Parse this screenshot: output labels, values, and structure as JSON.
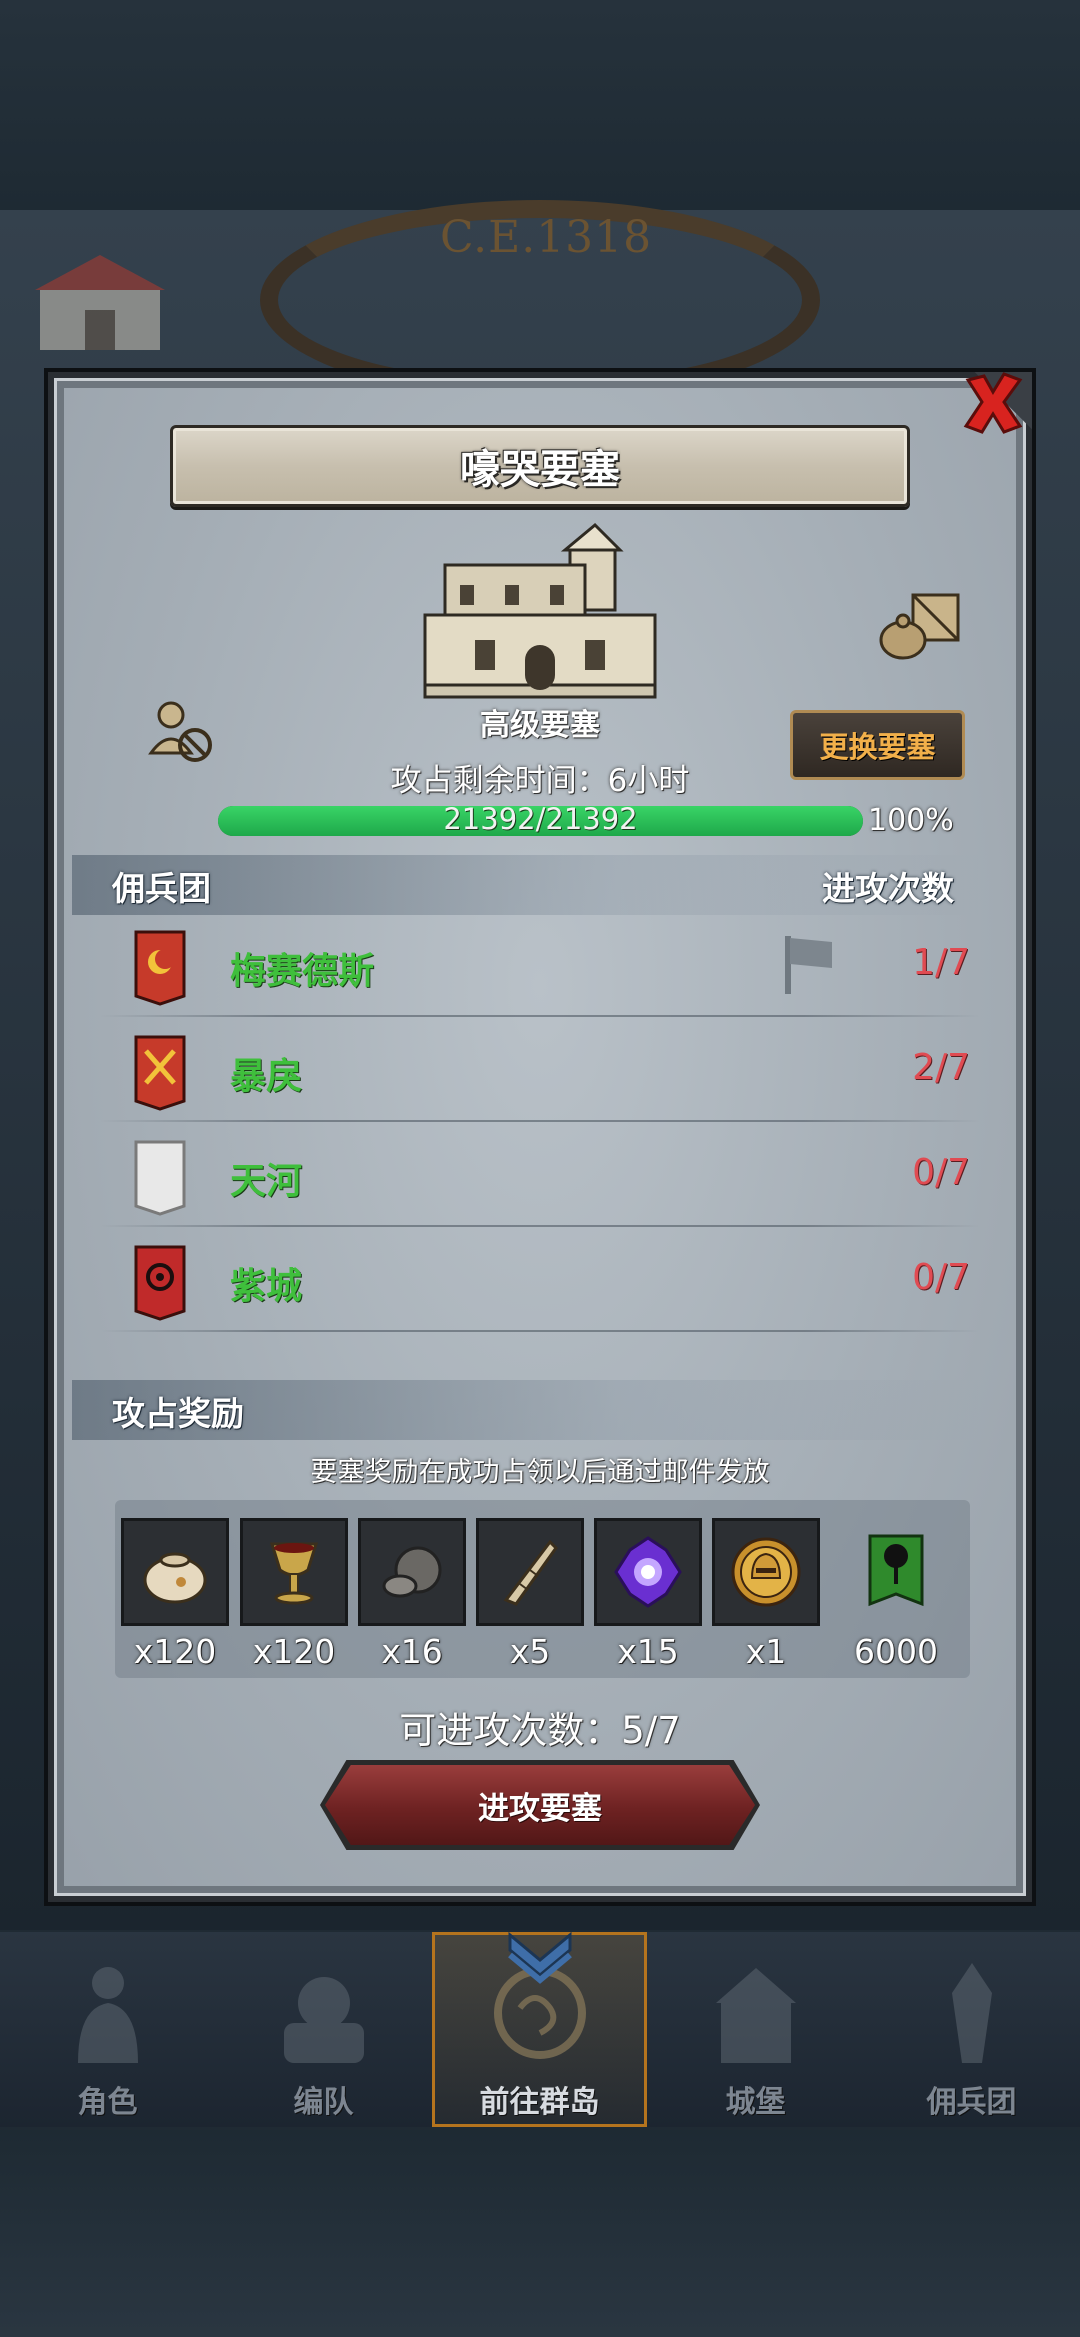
{
  "top": {
    "era": "C.E.1318"
  },
  "modal": {
    "title": "嚎哭要塞",
    "fortress_type": "高级要塞",
    "change_button": "更换要塞",
    "timer_label": "攻占剩余时间：6小时",
    "hp": {
      "current": 21392,
      "max": 21392,
      "text": "21392/21392",
      "percent_text": "100%",
      "fill_fraction": 1.0
    }
  },
  "mercenaries": {
    "header_left": "佣兵团",
    "header_right": "进攻次数",
    "rows": [
      {
        "name": "梅赛德斯",
        "count": "1/7",
        "banner_color": "#c63a2a",
        "emblem": "crescent-moon",
        "flag": true
      },
      {
        "name": "暴戾",
        "count": "2/7",
        "banner_color": "#c63a2a",
        "emblem": "crossed-swords",
        "flag": false
      },
      {
        "name": "天河",
        "count": "0/7",
        "banner_color": "#e8e8e8",
        "emblem": "blank",
        "flag": false
      },
      {
        "name": "紫城",
        "count": "0/7",
        "banner_color": "#c02a2a",
        "emblem": "target",
        "flag": false
      }
    ]
  },
  "rewards": {
    "header": "攻占奖励",
    "note": "要塞奖励在成功占领以后通过邮件发放",
    "items": [
      {
        "name": "grain-sack-icon",
        "qty": "x120"
      },
      {
        "name": "goblet-icon",
        "qty": "x120"
      },
      {
        "name": "truffle-icon",
        "qty": "x16"
      },
      {
        "name": "horn-icon",
        "qty": "x5"
      },
      {
        "name": "purple-gem-icon",
        "qty": "x15"
      },
      {
        "name": "gold-helmet-coin-icon",
        "qty": "x1"
      },
      {
        "name": "guild-banner-icon",
        "qty": "6000"
      }
    ]
  },
  "attempts_label": "可进攻次数：5/7",
  "attack_button": "进攻要塞",
  "nav": {
    "tabs": [
      {
        "label": "角色",
        "active": false
      },
      {
        "label": "编队",
        "active": false
      },
      {
        "label": "前往群岛",
        "active": true
      },
      {
        "label": "城堡",
        "active": false
      },
      {
        "label": "佣兵团",
        "active": false
      }
    ]
  },
  "colors": {
    "merc_name": "#3fbf3c",
    "count_red": "#e04b52",
    "accent_orange": "#f2b04a",
    "hp_green": "#2fc35a"
  }
}
